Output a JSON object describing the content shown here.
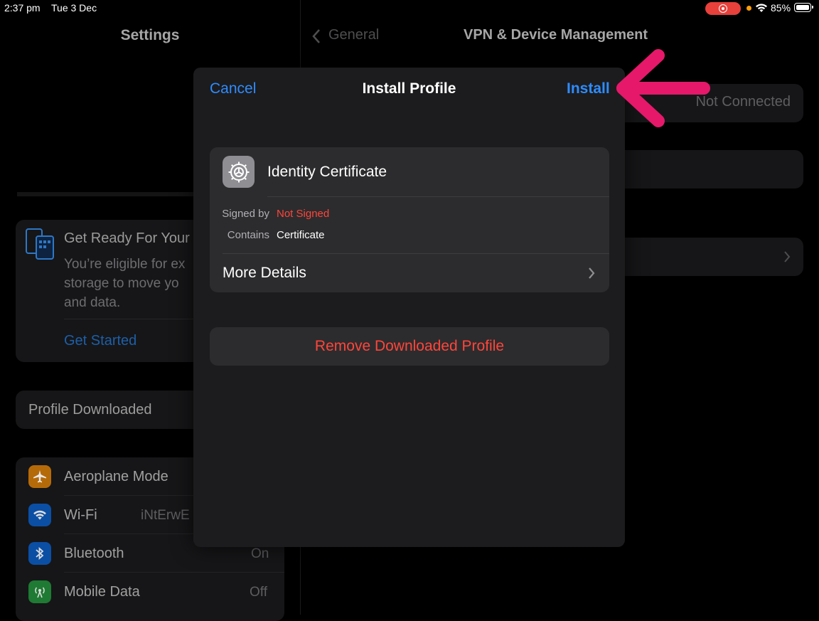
{
  "status_bar": {
    "time": "2:37 pm",
    "date": "Tue 3 Dec",
    "battery": "85%"
  },
  "left_pane": {
    "title": "Settings",
    "banner": {
      "title": "Get Ready For Your",
      "body": "You’re eligible for ex storage to move yo and data.",
      "link": "Get Started"
    },
    "profile_row": "Profile Downloaded",
    "rows": [
      {
        "label": "Aeroplane Mode",
        "value": "",
        "icon": "airplane-icon",
        "color": "#b56a09"
      },
      {
        "label": "Wi-Fi",
        "value": "iNtErwE",
        "icon": "wifi-icon",
        "color": "#0b4fa5"
      },
      {
        "label": "Bluetooth",
        "value": "On",
        "icon": "bluetooth-icon",
        "color": "#0b4fa5"
      },
      {
        "label": "Mobile Data",
        "value": "Off",
        "icon": "antenna-icon",
        "color": "#1f7a33"
      }
    ]
  },
  "right_pane": {
    "back": "General",
    "title": "VPN & Device Management",
    "vpn_status": "Not Connected"
  },
  "sheet": {
    "cancel": "Cancel",
    "title": "Install Profile",
    "install": "Install",
    "profile_name": "Identity Certificate",
    "signed_by_label": "Signed by",
    "signed_by_value": "Not Signed",
    "contains_label": "Contains",
    "contains_value": "Certificate",
    "more_details": "More Details",
    "remove": "Remove Downloaded Profile"
  },
  "colors": {
    "accent": "#2e8cff",
    "destructive": "#ff453a",
    "annotation_arrow": "#e6186a"
  }
}
